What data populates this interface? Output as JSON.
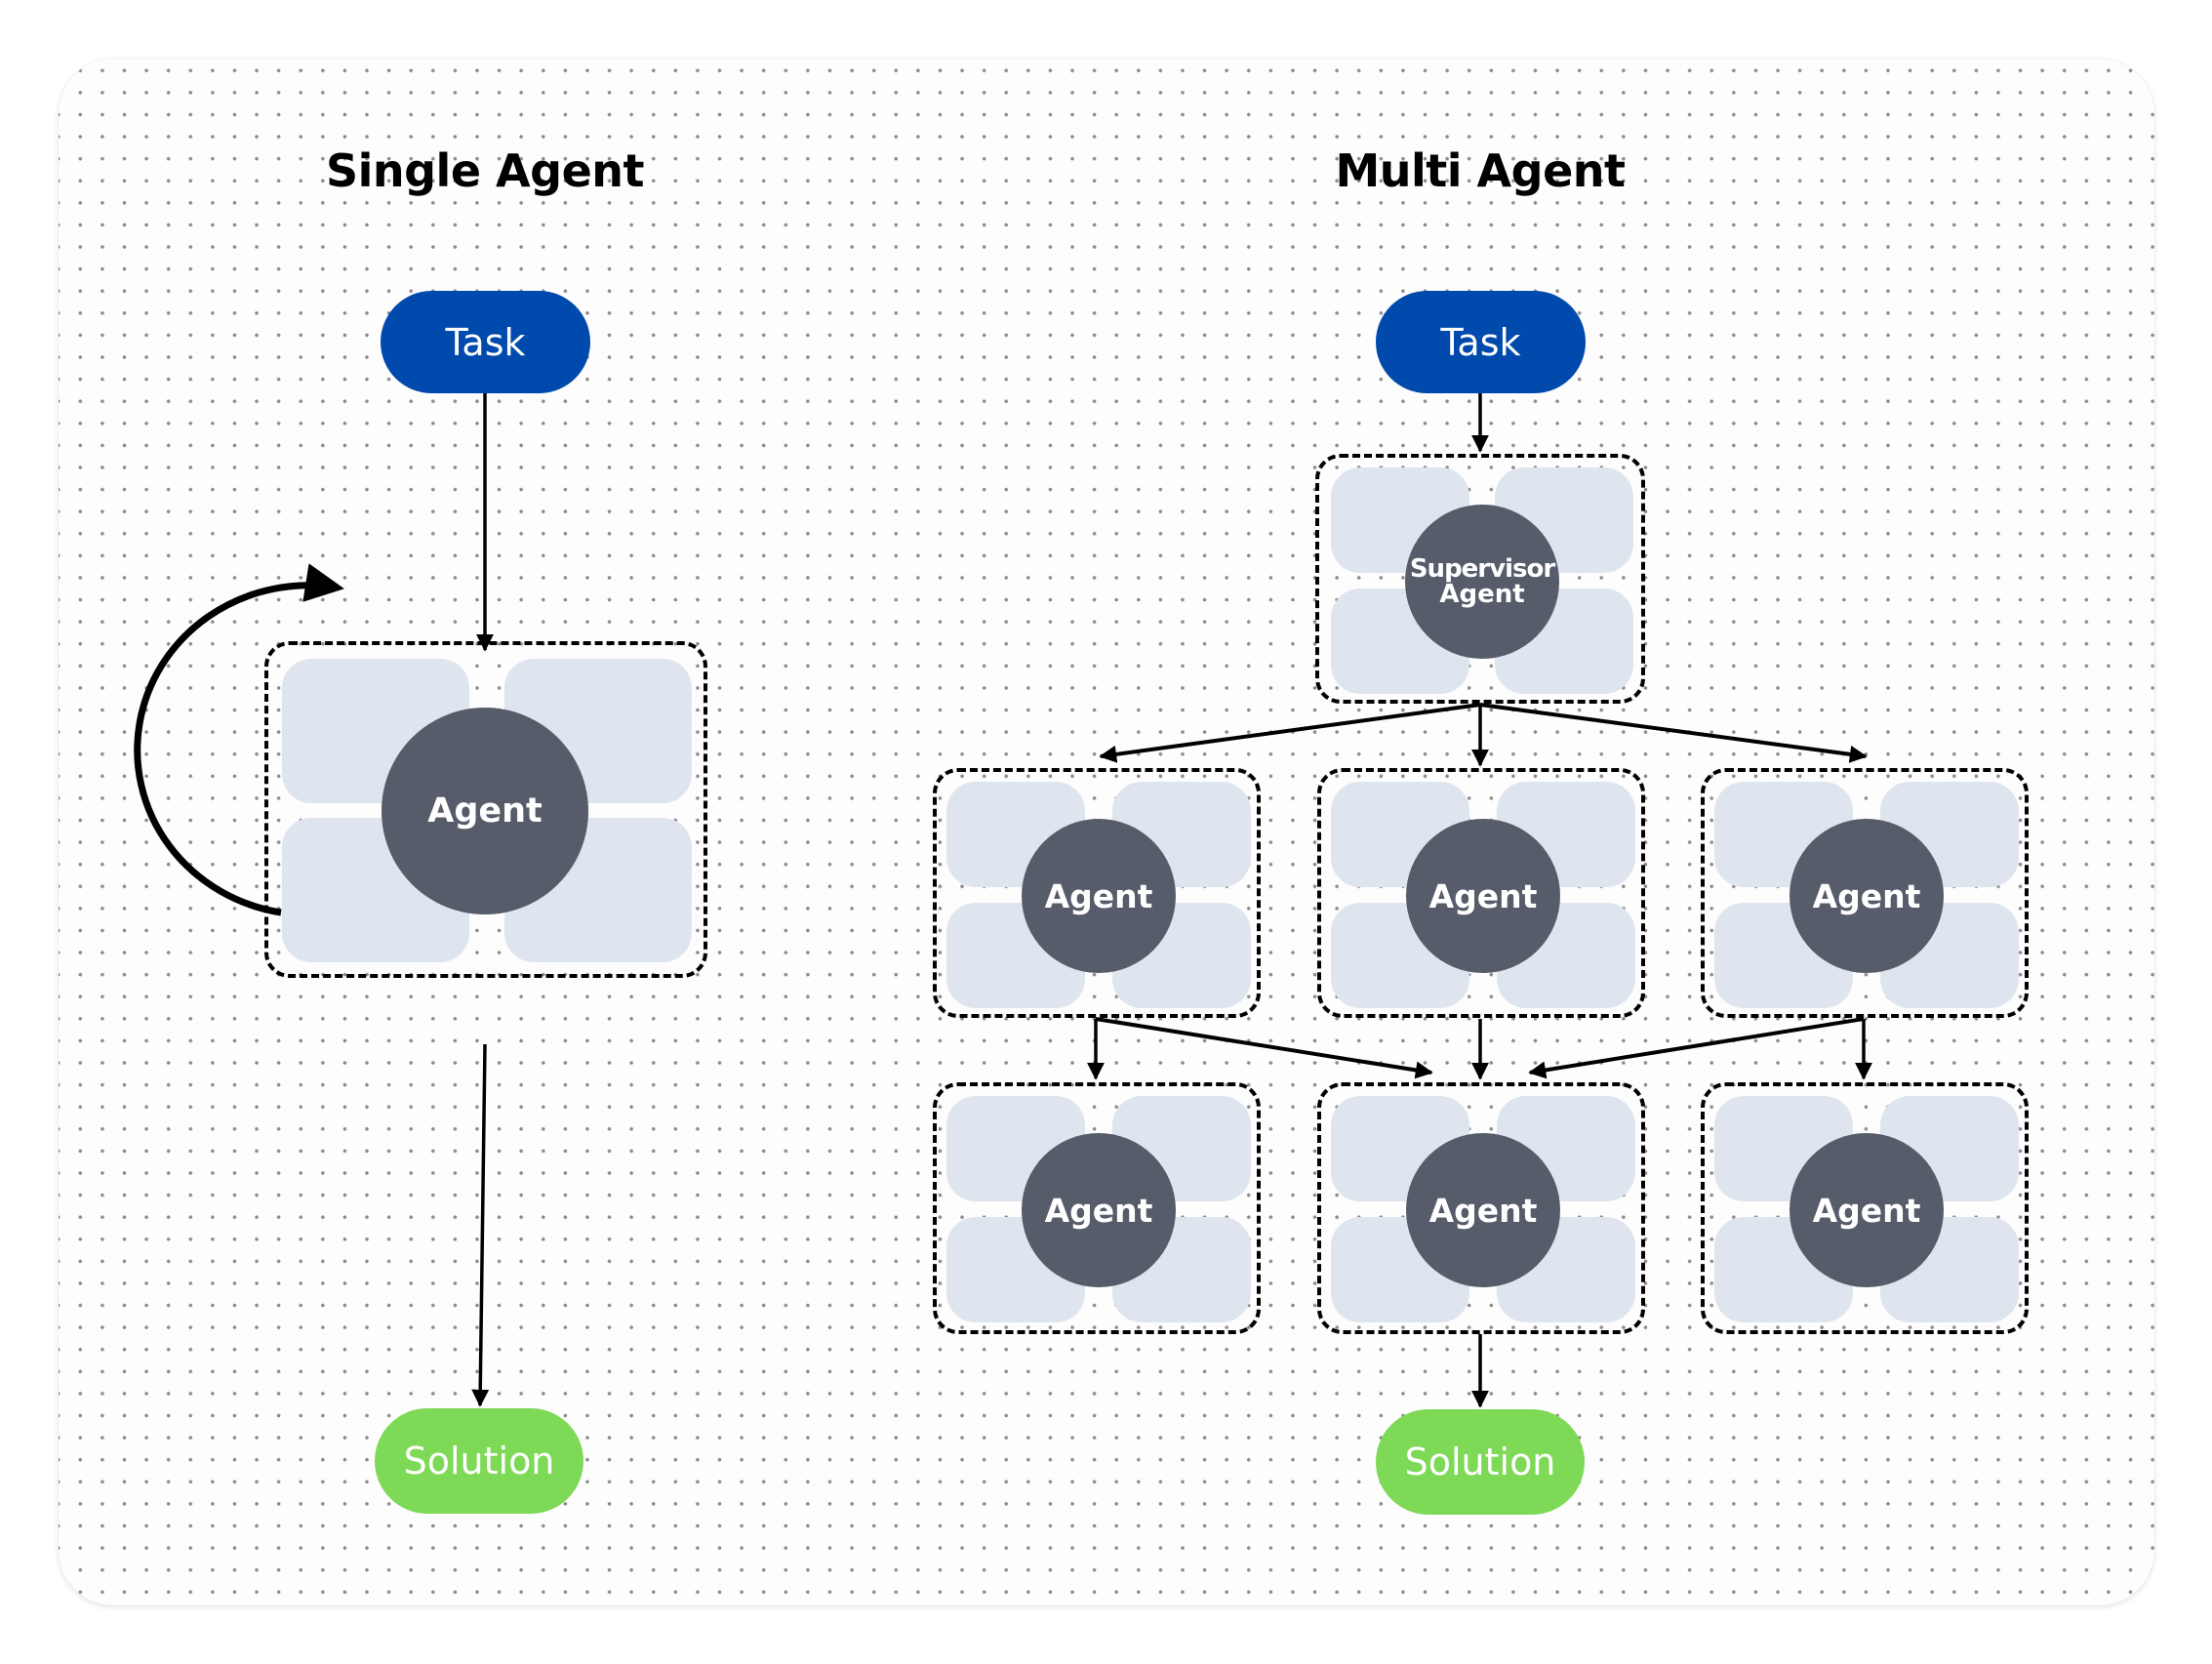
{
  "colors": {
    "task": "#004AAD",
    "solution": "#7ED957",
    "agent_circle": "#575C6B",
    "agent_quadrant": "#DFE5EE",
    "stroke": "#000000"
  },
  "single": {
    "title": "Single Agent",
    "task_label": "Task",
    "agent_label": "Agent",
    "solution_label": "Solution",
    "loop": "self-loop arrow around agent"
  },
  "multi": {
    "title": "Multi Agent",
    "task_label": "Task",
    "supervisor_label_line1": "Supervisor",
    "supervisor_label_line2": "Agent",
    "row1": [
      {
        "label": "Agent"
      },
      {
        "label": "Agent"
      },
      {
        "label": "Agent"
      }
    ],
    "row2": [
      {
        "label": "Agent"
      },
      {
        "label": "Agent"
      },
      {
        "label": "Agent"
      }
    ],
    "solution_label": "Solution",
    "edges": [
      {
        "from": "task",
        "to": "supervisor"
      },
      {
        "from": "supervisor",
        "to": "row1.0"
      },
      {
        "from": "supervisor",
        "to": "row1.1"
      },
      {
        "from": "supervisor",
        "to": "row1.2"
      },
      {
        "from": "row1.0",
        "to": "row2.0"
      },
      {
        "from": "row1.0",
        "to": "row2.1"
      },
      {
        "from": "row1.1",
        "to": "row2.1"
      },
      {
        "from": "row1.2",
        "to": "row2.1"
      },
      {
        "from": "row1.2",
        "to": "row2.2"
      },
      {
        "from": "row2.1",
        "to": "solution"
      }
    ]
  }
}
